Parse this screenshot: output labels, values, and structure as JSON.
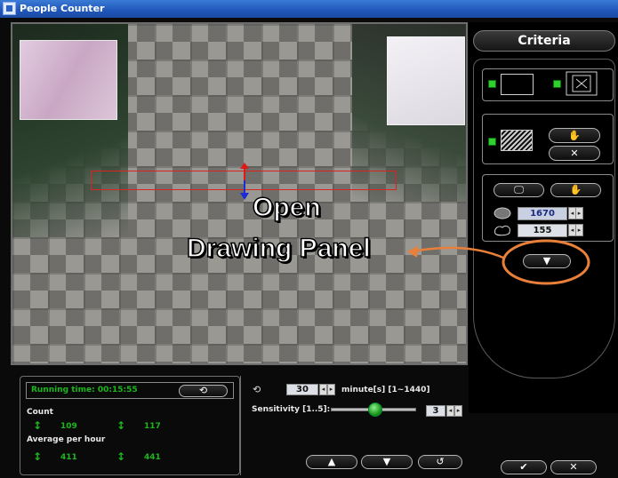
{
  "window": {
    "title": "People Counter"
  },
  "criteria_panel": {
    "tab_label": "Criteria",
    "value_1": "1670",
    "value_2": "155"
  },
  "overlay_hint": {
    "line1": "Open",
    "line2": "Drawing Panel"
  },
  "stats": {
    "running_time": "Running time: 00:15:55",
    "count_label": "Count",
    "count_in": "109",
    "count_out": "117",
    "avg_label": "Average per hour",
    "avg_in": "411",
    "avg_out": "441"
  },
  "interval": {
    "value": "30",
    "unit_label": "minute[s] [1~1440]",
    "sensitivity_label": "Sensitivity [1..5]:",
    "sensitivity_value": "3"
  },
  "colors": {
    "accent_green": "#1bb81b",
    "count_line": "#dd2222",
    "callout": "#e8803a"
  },
  "icons": [
    "app-icon",
    "rectangle-icon",
    "person-zone-icon",
    "hatch-area-icon",
    "hand-icon",
    "close-icon",
    "monitor-icon",
    "area-fill-icon",
    "blob-icon",
    "chevron-down-icon",
    "camera-rotate-icon",
    "arrow-up-icon",
    "arrow-down-icon",
    "reset-icon",
    "check-icon"
  ]
}
